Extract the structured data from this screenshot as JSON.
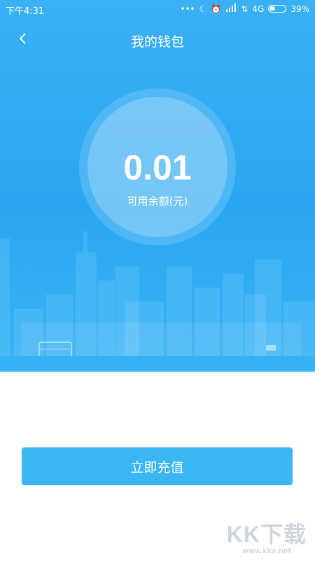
{
  "status_bar": {
    "time": "下午4:31",
    "icons": [
      "more-dots-icon",
      "moon-icon",
      "alarm-icon",
      "signal-hd-icon",
      "data-arrows-icon"
    ],
    "network": "4G",
    "battery_percent": "39%",
    "battery_level": 0.39
  },
  "header": {
    "back_icon": "chevron-left-icon",
    "title": "我的钱包"
  },
  "wallet": {
    "balance": "0.01",
    "balance_label": "可用余额(元)"
  },
  "actions": {
    "recharge_label": "立即充值"
  },
  "watermark": {
    "logo": "KK下载",
    "url": "www.kkx.net"
  },
  "colors": {
    "hero_blue": "#2aa7f2",
    "button_blue": "#3bb6f5",
    "text_white": "#ffffff"
  }
}
